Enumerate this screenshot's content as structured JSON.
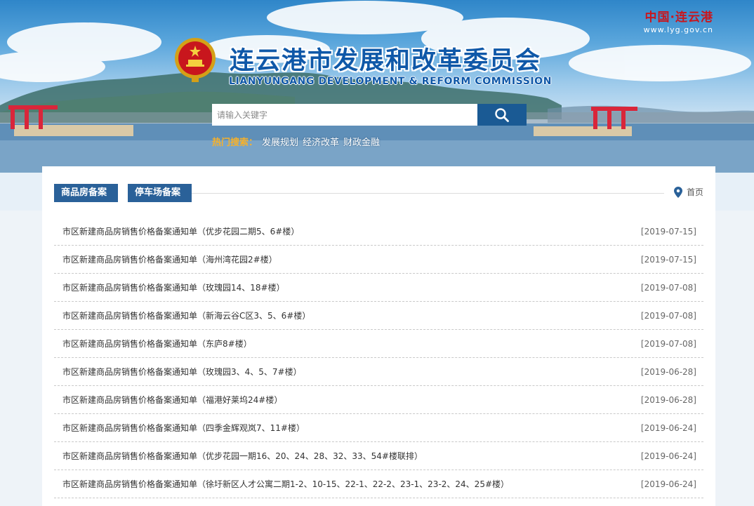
{
  "header": {
    "site_mark": "中国·连云港",
    "site_url": "www.lyg.gov.cn",
    "title_cn": "连云港市发展和改革委员会",
    "title_en": "LIANYUNGANG DEVELOPMENT & REFORM COMMISSION",
    "search": {
      "placeholder": "请输入关键字"
    },
    "hot_label": "热门搜索：",
    "hot_items": [
      "发展规划",
      "经济改革",
      "财政金融"
    ]
  },
  "tabs": [
    {
      "label": "商品房备案"
    },
    {
      "label": "停车场备案"
    }
  ],
  "breadcrumb": {
    "home": "首页"
  },
  "list": [
    {
      "title": "市区新建商品房销售价格备案通知单（优步花园二期5、6#楼）",
      "date": "[2019-07-15]"
    },
    {
      "title": "市区新建商品房销售价格备案通知单（海州湾花园2#楼）",
      "date": "[2019-07-15]"
    },
    {
      "title": "市区新建商品房销售价格备案通知单（玫瑰园14、18#楼）",
      "date": "[2019-07-08]"
    },
    {
      "title": "市区新建商品房销售价格备案通知单（新海云谷C区3、5、6#楼）",
      "date": "[2019-07-08]"
    },
    {
      "title": "市区新建商品房销售价格备案通知单（东庐8#楼）",
      "date": "[2019-07-08]"
    },
    {
      "title": "市区新建商品房销售价格备案通知单（玫瑰园3、4、5、7#楼）",
      "date": "[2019-06-28]"
    },
    {
      "title": "市区新建商品房销售价格备案通知单（福港好莱坞24#楼）",
      "date": "[2019-06-28]"
    },
    {
      "title": "市区新建商品房销售价格备案通知单（四季金辉观岚7、11#楼）",
      "date": "[2019-06-24]"
    },
    {
      "title": "市区新建商品房销售价格备案通知单（优步花园一期16、20、24、28、32、33、54#楼联排）",
      "date": "[2019-06-24]"
    },
    {
      "title": "市区新建商品房销售价格备案通知单（徐圩新区人才公寓二期1-2、10-15、22-1、22-2、23-1、23-2、24、25#楼）",
      "date": "[2019-06-24]"
    }
  ],
  "colors": {
    "brand_blue": "#0f58a8",
    "tab_blue": "#2a6199",
    "site_red": "#c8161d",
    "hot_orange": "#f6b12b"
  },
  "icons": {
    "search": "search-icon",
    "location": "location-pin-icon",
    "emblem": "national-emblem-icon"
  }
}
